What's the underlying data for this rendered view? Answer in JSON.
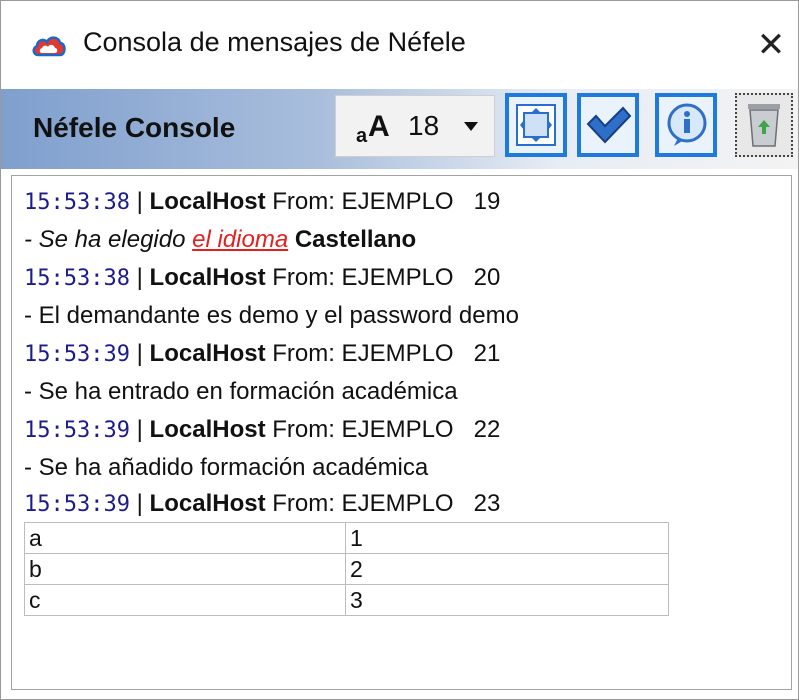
{
  "window": {
    "title": "Consola de mensajes de Néfele",
    "close_glyph": "✕"
  },
  "toolbar": {
    "brand": "Néfele Console",
    "font_size": "18",
    "buttons": [
      "fit-icon",
      "check-icon",
      "info-icon",
      "trash-icon"
    ]
  },
  "console": {
    "entries": [
      {
        "time": "15:53:38",
        "sep": " | ",
        "host": "LocalHost",
        "from": " From: EJEMPLO",
        "num": "19"
      },
      {
        "time": "15:53:38",
        "sep": " | ",
        "host": "LocalHost",
        "from": " From: EJEMPLO",
        "num": "20"
      },
      {
        "time": "15:53:39",
        "sep": " | ",
        "host": "LocalHost",
        "from": " From: EJEMPLO",
        "num": "21"
      },
      {
        "time": "15:53:39",
        "sep": " | ",
        "host": "LocalHost",
        "from": " From: EJEMPLO",
        "num": "22"
      },
      {
        "time": "15:53:39",
        "sep": " | ",
        "host": "LocalHost",
        "from": " From: EJEMPLO",
        "num": "23"
      }
    ],
    "messages": {
      "m1_prefix": "- Se ha elegido ",
      "m1_link": "el idioma",
      "m1_value": "Castellano",
      "m2": "- El demandante es demo y el password demo",
      "m3": "- Se ha entrado en formación académica",
      "m4": "- Se ha añadido formación académica"
    },
    "table": [
      [
        "a",
        "1"
      ],
      [
        "b",
        "2"
      ],
      [
        "c",
        "3"
      ]
    ]
  },
  "colors": {
    "timestamp": "#1c1c8c",
    "link": "#e32020",
    "button_border": "#1f7ae0"
  }
}
